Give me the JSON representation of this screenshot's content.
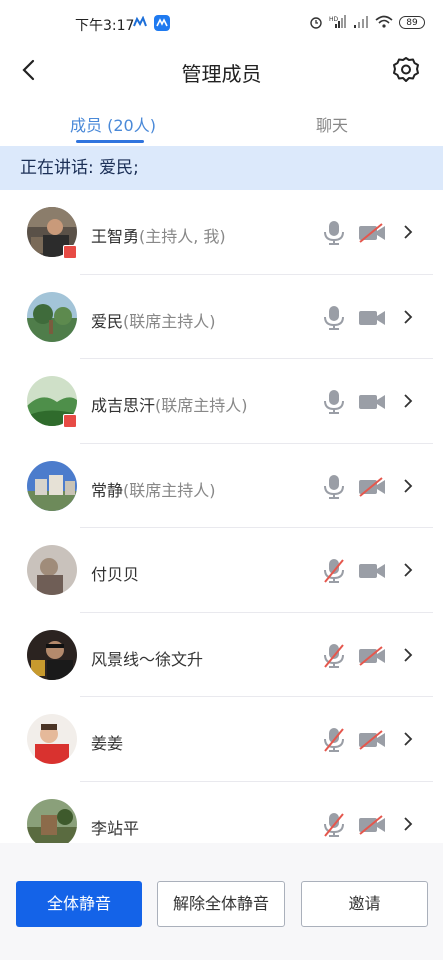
{
  "status_bar": {
    "time": "下午3:17",
    "battery": "89"
  },
  "header": {
    "title": "管理成员"
  },
  "tabs": [
    {
      "label": "成员 (20人)",
      "active": true
    },
    {
      "label": "聊天",
      "active": false
    }
  ],
  "speaking": {
    "text": "正在讲话: 爱民;"
  },
  "members": [
    {
      "name": "王智勇",
      "role": "(主持人, 我)",
      "mic_on": true,
      "cam_on": false,
      "host_badge": true
    },
    {
      "name": "爱民",
      "role": "(联席主持人)",
      "mic_on": true,
      "cam_on": true,
      "host_badge": false
    },
    {
      "name": "成吉思汗",
      "role": "(联席主持人)",
      "mic_on": true,
      "cam_on": true,
      "host_badge": true
    },
    {
      "name": "常静",
      "role": "(联席主持人)",
      "mic_on": true,
      "cam_on": false,
      "host_badge": false
    },
    {
      "name": "付贝贝",
      "role": "",
      "mic_on": false,
      "cam_on": true,
      "host_badge": false
    },
    {
      "name": "风景线～徐文升",
      "role": "",
      "mic_on": false,
      "cam_on": false,
      "host_badge": false
    },
    {
      "name": "姜姜",
      "role": "",
      "mic_on": false,
      "cam_on": false,
      "host_badge": false
    },
    {
      "name": "李站平",
      "role": "",
      "mic_on": false,
      "cam_on": false,
      "host_badge": false
    }
  ],
  "footer": {
    "mute_all": "全体静音",
    "unmute_all": "解除全体静音",
    "invite": "邀请"
  },
  "colors": {
    "accent": "#1463e8",
    "speaking_bg": "#dce9fb",
    "muted_red": "#e5574d"
  }
}
